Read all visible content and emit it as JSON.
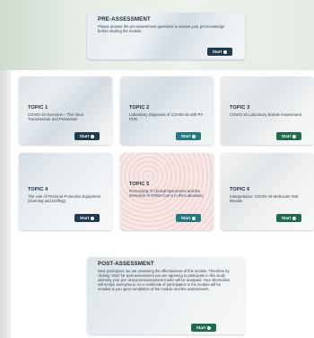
{
  "pre": {
    "title": "PRE-ASSESSMENT",
    "desc": "Please answer the pre-assessment questions to assess your pre-knowledge before starting the module",
    "button": "Start",
    "button_color": "#1f3b4f"
  },
  "topics": [
    {
      "title": "TOPIC 1",
      "desc": "COVID-19 Overview – The Virus, Transmission and Prevention",
      "button": "Start",
      "button_color": "#1f3b4f"
    },
    {
      "title": "TOPIC 2",
      "desc": "Laboratory Diagnosis of COVID-19 with RT-PCR",
      "button": "Start",
      "button_color": "#237a7e"
    },
    {
      "title": "TOPIC 3",
      "desc": "COVID-19 Laboratory Biorisk Assessment",
      "button": "Start",
      "button_color": "#1f6b4d"
    },
    {
      "title": "TOPIC 4",
      "desc": "The Use of Personal Protective Equipment (Donning and Doffing)",
      "button": "Start",
      "button_color": "#1f3b4f"
    },
    {
      "title": "TOPIC 5",
      "desc": "Processing of Clinical Specimens and the Detection of SARS-CoV-2 in the Laboratory",
      "button": "Start",
      "button_color": "#237a7e"
    },
    {
      "title": "TOPIC 6",
      "desc": "Interpretation: COVID-19 Molecular Test Results",
      "button": "Start",
      "button_color": "#1f6b4d"
    }
  ],
  "post": {
    "title": "POST-ASSESSMENT",
    "desc": "Dear participant, we are assessing the effectiveness of this module. Therefore by clicking 'Start' for post-assessment you are agreeing to participate in this study whereby your pre- and post-assessment marks will be analysed. Your information will remain anonymous. An e-certificate of participation in the module will be emailed to you upon completion of the module and the assessments.",
    "button": "Start",
    "button_color": "#1f6b4d"
  }
}
